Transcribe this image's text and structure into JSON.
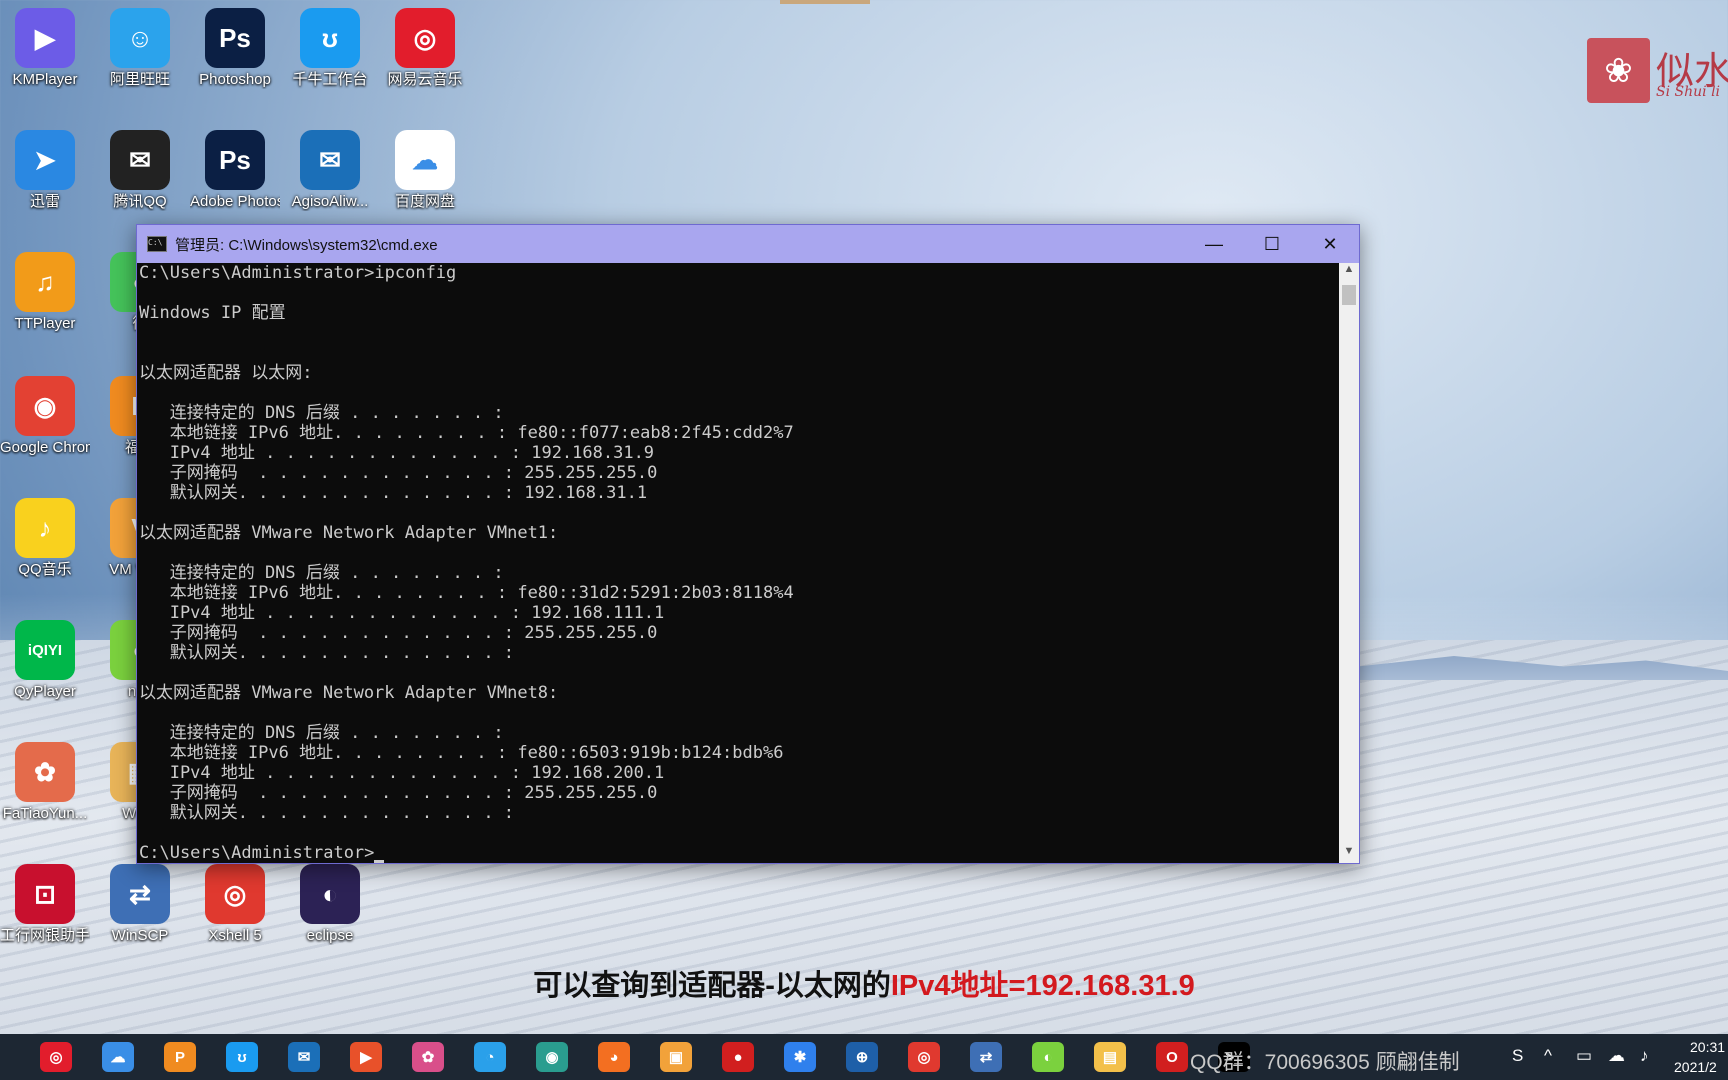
{
  "desktop": {
    "icons": [
      {
        "label": "KMPlayer",
        "glyph": "▶",
        "color": "#6c5ce7"
      },
      {
        "label": "阿里旺旺",
        "glyph": "☺",
        "color": "#2ba3ec"
      },
      {
        "label": "Photoshop",
        "glyph": "Ps",
        "color": "#0b1f44"
      },
      {
        "label": "千牛工作台",
        "glyph": "ʊ",
        "color": "#1a9bf0"
      },
      {
        "label": "网易云音乐",
        "glyph": "◎",
        "color": "#e21d2c"
      },
      {
        "label": "迅雷",
        "glyph": "➤",
        "color": "#2a88e2"
      },
      {
        "label": "腾讯QQ",
        "glyph": "✉",
        "color": "#222222"
      },
      {
        "label": "Adobe Photosh",
        "glyph": "Ps",
        "color": "#0b1f44"
      },
      {
        "label": "AgisoAliw...",
        "glyph": "✉",
        "color": "#1b6fb8"
      },
      {
        "label": "百度网盘",
        "glyph": "☁",
        "color": "#ffffff"
      },
      {
        "label": "TTPlayer",
        "glyph": "♫",
        "color": "#f29b19"
      },
      {
        "label": "微",
        "glyph": "◐",
        "color": "#45c35a"
      },
      {
        "label": "Google Chrome",
        "glyph": "◉",
        "color": "#e34133"
      },
      {
        "label": "福昕",
        "glyph": "P",
        "color": "#f08b20"
      },
      {
        "label": "QQ音乐",
        "glyph": "♪",
        "color": "#f9d11e"
      },
      {
        "label": "VM Work",
        "glyph": "V",
        "color": "#f2a23a"
      },
      {
        "label": "QyPlayer",
        "glyph": "iQIYI",
        "color": "#00b74a"
      },
      {
        "label": "nav",
        "glyph": "◐",
        "color": "#7bd13e"
      },
      {
        "label": "FaTiaoYun...",
        "glyph": "✿",
        "color": "#e46b4b"
      },
      {
        "label": "WinP",
        "glyph": "▦",
        "color": "#e8b459"
      },
      {
        "label": "工行网银助手",
        "glyph": "⊡",
        "color": "#c8102e"
      },
      {
        "label": "WinSCP",
        "glyph": "⇄",
        "color": "#3e6fb5"
      },
      {
        "label": "Xshell 5",
        "glyph": "◎",
        "color": "#e0392f"
      },
      {
        "label": "eclipse",
        "glyph": "◐",
        "color": "#2c2255"
      }
    ]
  },
  "watermark": {
    "logo_text": "似水",
    "logo_sub": "Si Shui li"
  },
  "cmd": {
    "title": "管理员: C:\\Windows\\system32\\cmd.exe",
    "minimize": "—",
    "maximize": "☐",
    "close": "✕",
    "lines": [
      "C:\\Users\\Administrator>ipconfig",
      "",
      "Windows IP 配置",
      "",
      "",
      "以太网适配器 以太网:",
      "",
      "   连接特定的 DNS 后缀 . . . . . . . :",
      "   本地链接 IPv6 地址. . . . . . . . : fe80::f077:eab8:2f45:cdd2%7",
      "   IPv4 地址 . . . . . . . . . . . . : 192.168.31.9",
      "   子网掩码  . . . . . . . . . . . . : 255.255.255.0",
      "   默认网关. . . . . . . . . . . . . : 192.168.31.1",
      "",
      "以太网适配器 VMware Network Adapter VMnet1:",
      "",
      "   连接特定的 DNS 后缀 . . . . . . . :",
      "   本地链接 IPv6 地址. . . . . . . . : fe80::31d2:5291:2b03:8118%4",
      "   IPv4 地址 . . . . . . . . . . . . : 192.168.111.1",
      "   子网掩码  . . . . . . . . . . . . : 255.255.255.0",
      "   默认网关. . . . . . . . . . . . . :",
      "",
      "以太网适配器 VMware Network Adapter VMnet8:",
      "",
      "   连接特定的 DNS 后缀 . . . . . . . :",
      "   本地链接 IPv6 地址. . . . . . . . : fe80::6503:919b:b124:bdb%6",
      "   IPv4 地址 . . . . . . . . . . . . : 192.168.200.1",
      "   子网掩码  . . . . . . . . . . . . : 255.255.255.0",
      "   默认网关. . . . . . . . . . . . . :",
      "",
      "C:\\Users\\Administrator>"
    ]
  },
  "subtitle": {
    "normal": "可以查询到适配器-以太网的",
    "highlight": "IPv4地址=192.168.31.9"
  },
  "taskbar": {
    "icons": [
      {
        "name": "netease-music",
        "glyph": "◎",
        "color": "#e21d2c"
      },
      {
        "name": "baidu-netdisk",
        "glyph": "☁",
        "color": "#3a8ee6"
      },
      {
        "name": "foxit",
        "glyph": "P",
        "color": "#f08b20"
      },
      {
        "name": "qianniu",
        "glyph": "ʊ",
        "color": "#1a9bf0"
      },
      {
        "name": "agiso",
        "glyph": "✉",
        "color": "#1b6fb8"
      },
      {
        "name": "flag-app",
        "glyph": "▶",
        "color": "#e8512a"
      },
      {
        "name": "fatiaoyun",
        "glyph": "✿",
        "color": "#d94f8a"
      },
      {
        "name": "qq-search",
        "glyph": "◔",
        "color": "#2aa0ea"
      },
      {
        "name": "edge",
        "glyph": "◉",
        "color": "#2a9d8f"
      },
      {
        "name": "firefox",
        "glyph": "◕",
        "color": "#f36f21"
      },
      {
        "name": "vmware",
        "glyph": "▣",
        "color": "#f2a23a"
      },
      {
        "name": "recorder",
        "glyph": "●",
        "color": "#d11f1f"
      },
      {
        "name": "network-tool",
        "glyph": "✱",
        "color": "#2f80ed"
      },
      {
        "name": "remote-tool",
        "glyph": "⊕",
        "color": "#1e5fa8"
      },
      {
        "name": "xshell",
        "glyph": "◎",
        "color": "#e0392f"
      },
      {
        "name": "winscp",
        "glyph": "⇄",
        "color": "#3e6fb5"
      },
      {
        "name": "green-app",
        "glyph": "◐",
        "color": "#7bd13e"
      },
      {
        "name": "file-explorer",
        "glyph": "▤",
        "color": "#f3c04a"
      },
      {
        "name": "opera",
        "glyph": "O",
        "color": "#d11f1f"
      },
      {
        "name": "cmd",
        "glyph": ">_",
        "color": "#000000"
      }
    ],
    "overlay_text": "QQ群：700696305 顾翩佳制",
    "tray_icons": [
      "S",
      "^",
      "▭",
      "☁",
      "♪"
    ],
    "time": "20:31",
    "date": "2021/2"
  }
}
